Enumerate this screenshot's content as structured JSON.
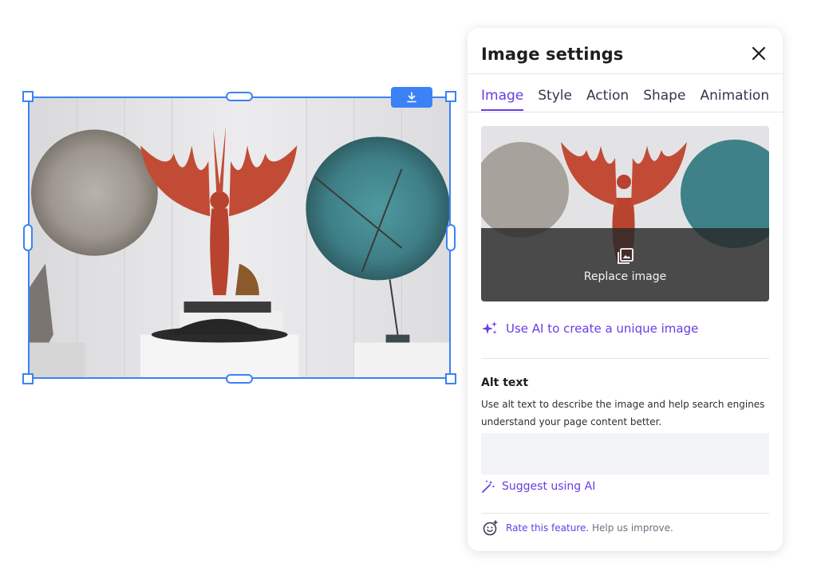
{
  "canvas": {
    "download_icon": "download-icon"
  },
  "panel": {
    "title": "Image settings",
    "close_icon": "close-icon",
    "tabs": [
      {
        "label": "Image",
        "active": true
      },
      {
        "label": "Style",
        "active": false
      },
      {
        "label": "Action",
        "active": false
      },
      {
        "label": "Shape",
        "active": false
      },
      {
        "label": "Animation",
        "active": false
      }
    ],
    "preview": {
      "replace_label": "Replace image",
      "replace_icon": "image-gallery-icon"
    },
    "ai_image_link": "Use AI to create a unique image",
    "ai_image_icon": "sparkles-icon",
    "alt_text": {
      "title": "Alt text",
      "description": "Use alt text to describe the image and help search engines understand your page content better.",
      "value": "",
      "suggest_label": "Suggest using AI",
      "suggest_icon": "magic-wand-icon"
    },
    "feedback": {
      "link": "Rate this feature.",
      "rest": " Help us improve.",
      "icon": "smiley-icon"
    }
  },
  "colors": {
    "accent": "#673de6",
    "selection": "#3b82f6",
    "panel_bg": "#ffffff",
    "input_bg": "#f2f3f6"
  }
}
